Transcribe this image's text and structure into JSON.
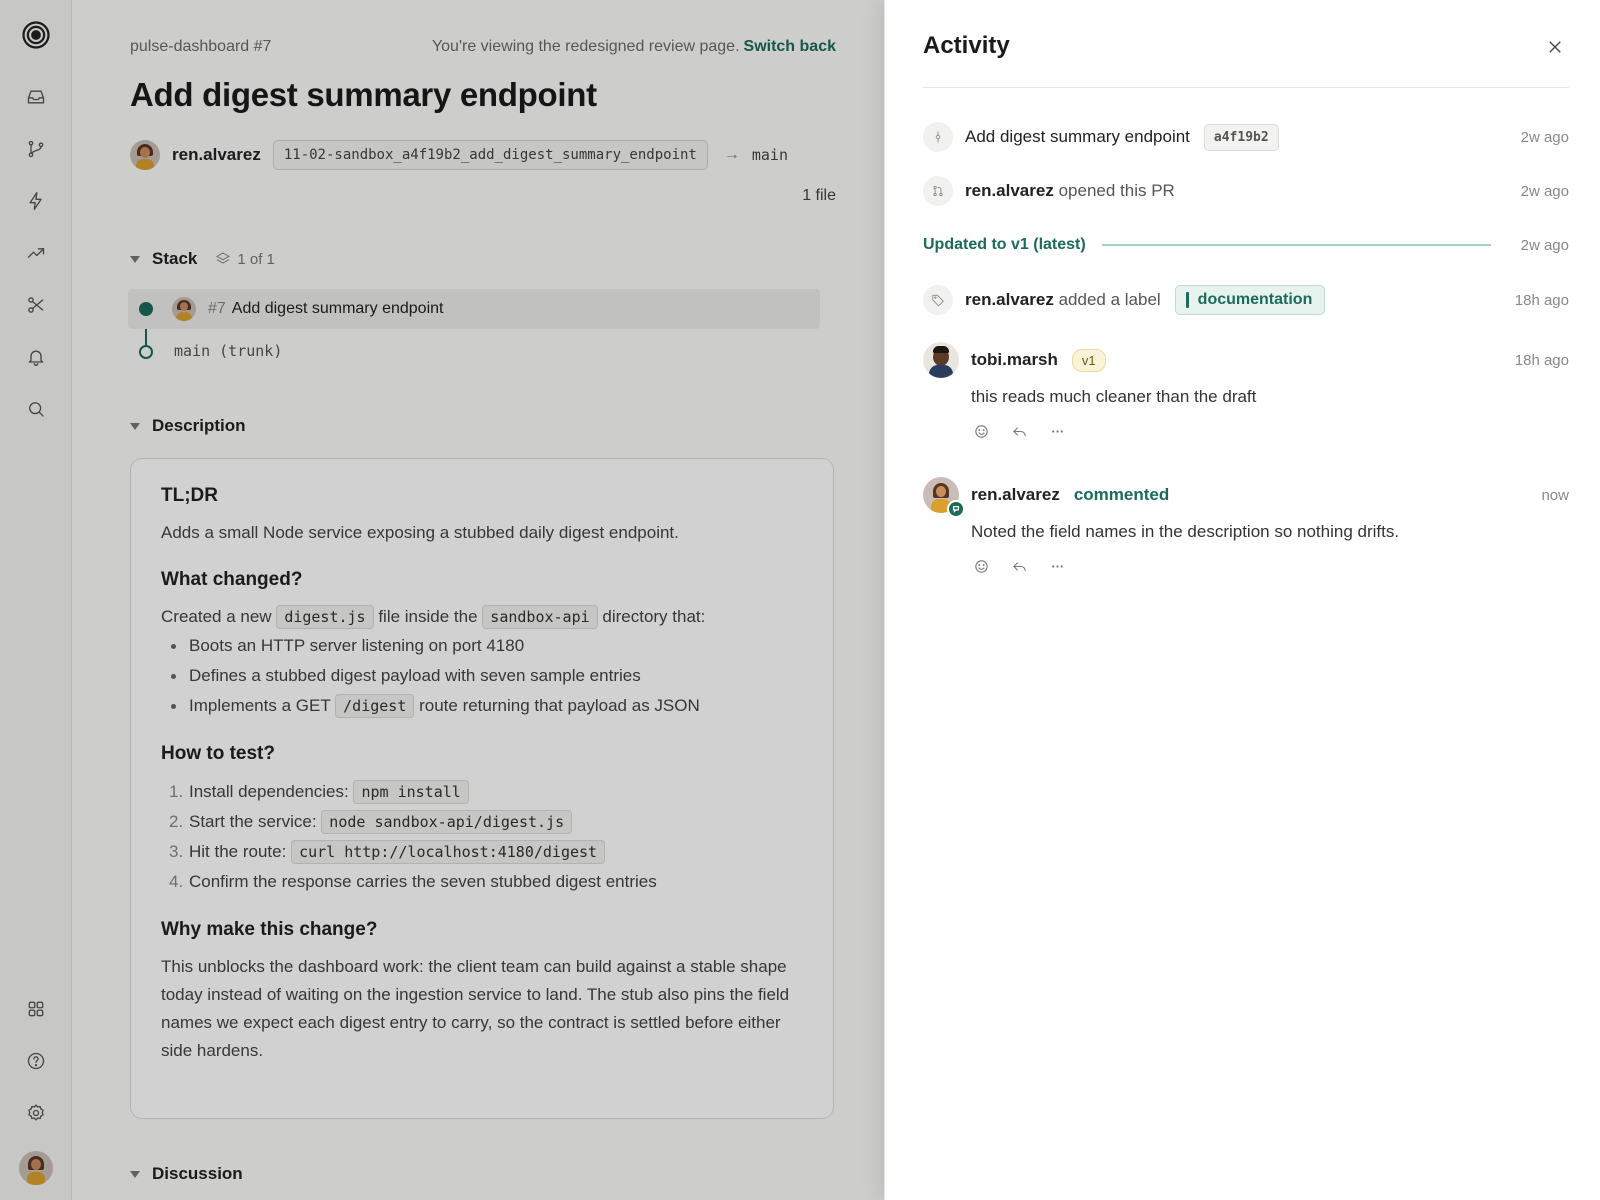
{
  "pr": {
    "crumb": "pulse-dashboard #7",
    "notice_text": "You're viewing the redesigned review page.",
    "notice_link": "Switch back",
    "title": "Add digest summary endpoint",
    "author": "ren.alvarez",
    "branch": "11-02-sandbox_a4f19b2_add_digest_summary_endpoint",
    "arrow": "→",
    "target_branch": "main",
    "files": "1 file"
  },
  "stack": {
    "heading": "Stack",
    "count": "1 of 1",
    "item_number": "#7",
    "item_title": "Add digest summary endpoint",
    "trunk": "main (trunk)"
  },
  "description": {
    "heading": "Description",
    "tldr_title": "TL;DR",
    "tldr_body": "Adds a small Node service exposing a stubbed daily digest endpoint.",
    "changed_title": "What changed?",
    "changed_pre": "Created a new",
    "changed_file": "digest.js",
    "changed_mid": "file inside the",
    "changed_dir": "sandbox-api",
    "changed_post": "directory that:",
    "bullets": [
      "Boots an HTTP server listening on port 4180",
      "Defines a stubbed digest payload with seven sample entries"
    ],
    "bullet3_pre": "Implements a GET",
    "bullet3_code": "/digest",
    "bullet3_post": "route returning that payload as JSON",
    "test_title": "How to test?",
    "steps": [
      {
        "n": "1.",
        "text": "Install dependencies:",
        "code": "npm install"
      },
      {
        "n": "2.",
        "text": "Start the service:",
        "code": "node sandbox-api/digest.js"
      },
      {
        "n": "3.",
        "text": "Hit the route:",
        "code": "curl http://localhost:4180/digest"
      },
      {
        "n": "4.",
        "text": "Confirm the response carries the seven stubbed digest entries",
        "code": ""
      }
    ],
    "why_title": "Why make this change?",
    "why_body": "This unblocks the dashboard work: the client team can build against a stable shape today instead of waiting on the ingestion service to land. The stub also pins the field names we expect each digest entry to carry, so the contract is settled before either side hardens."
  },
  "discussion": {
    "heading": "Discussion"
  },
  "activity": {
    "title": "Activity",
    "events": {
      "commit": {
        "title": "Add digest summary endpoint",
        "sha": "a4f19b2",
        "time": "2w ago"
      },
      "opened": {
        "user": "ren.alvarez",
        "text": "opened this PR",
        "time": "2w ago"
      },
      "update": {
        "text": "Updated to v1 (latest)",
        "time": "2w ago"
      },
      "label": {
        "user": "ren.alvarez",
        "text": "added a label",
        "label": "documentation",
        "time": "18h ago"
      }
    },
    "comments": [
      {
        "user": "tobi.marsh",
        "badge": "v1",
        "time": "18h ago",
        "body": "this reads much cleaner than the draft"
      },
      {
        "user": "ren.alvarez",
        "action": "commented",
        "time": "now",
        "body": "Noted the field names in the description so nothing drifts."
      }
    ]
  },
  "colors": {
    "accent": "#1a6b5a",
    "label_bg": "#e7f3ef",
    "badge_bg": "#fbf3d6"
  },
  "icons": {
    "rail": [
      "app-logo-icon",
      "inbox-icon",
      "branch-icon",
      "bolt-icon",
      "chart-icon",
      "merge-icon",
      "bell-icon",
      "search-icon",
      "grid-icon",
      "help-icon",
      "settings-icon",
      "user-avatar"
    ]
  }
}
